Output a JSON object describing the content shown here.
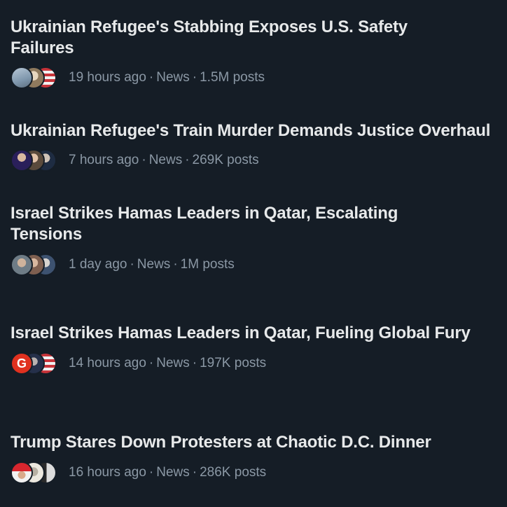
{
  "stories": [
    {
      "title": "Ukrainian Refugee's Stabbing Exposes U.S. Safety Failures",
      "time": "19 hours ago",
      "category": "News",
      "posts": "1.5M posts",
      "avatar_colors": [
        "#8fa7bd",
        "#b9a98a",
        "#c44a4a"
      ]
    },
    {
      "title": "Ukrainian Refugee's Train Murder Demands Justice Overhaul",
      "time": "7 hours ago",
      "category": "News",
      "posts": "269K posts",
      "avatar_colors": [
        "#3a2a6e",
        "#6b5a4a",
        "#2c3e58"
      ]
    },
    {
      "title": "Israel Strikes Hamas Leaders in Qatar, Escalating Tensions",
      "time": "1 day ago",
      "category": "News",
      "posts": "1M posts",
      "avatar_colors": [
        "#7a8a95",
        "#9a7a6a",
        "#5a6e88"
      ]
    },
    {
      "title": "Israel Strikes Hamas Leaders in Qatar, Fueling Global Fury",
      "time": "14 hours ago",
      "category": "News",
      "posts": "197K posts",
      "avatar_colors": [
        "#e0311f",
        "#2a3550",
        "#c2c6cc"
      ]
    },
    {
      "title": "Trump Stares Down Protesters at Chaotic D.C. Dinner",
      "time": "16 hours ago",
      "category": "News",
      "posts": "286K posts",
      "avatar_colors": [
        "#d7262e",
        "#c7c2b6",
        "#3a3a3a"
      ]
    }
  ],
  "separator": "·"
}
